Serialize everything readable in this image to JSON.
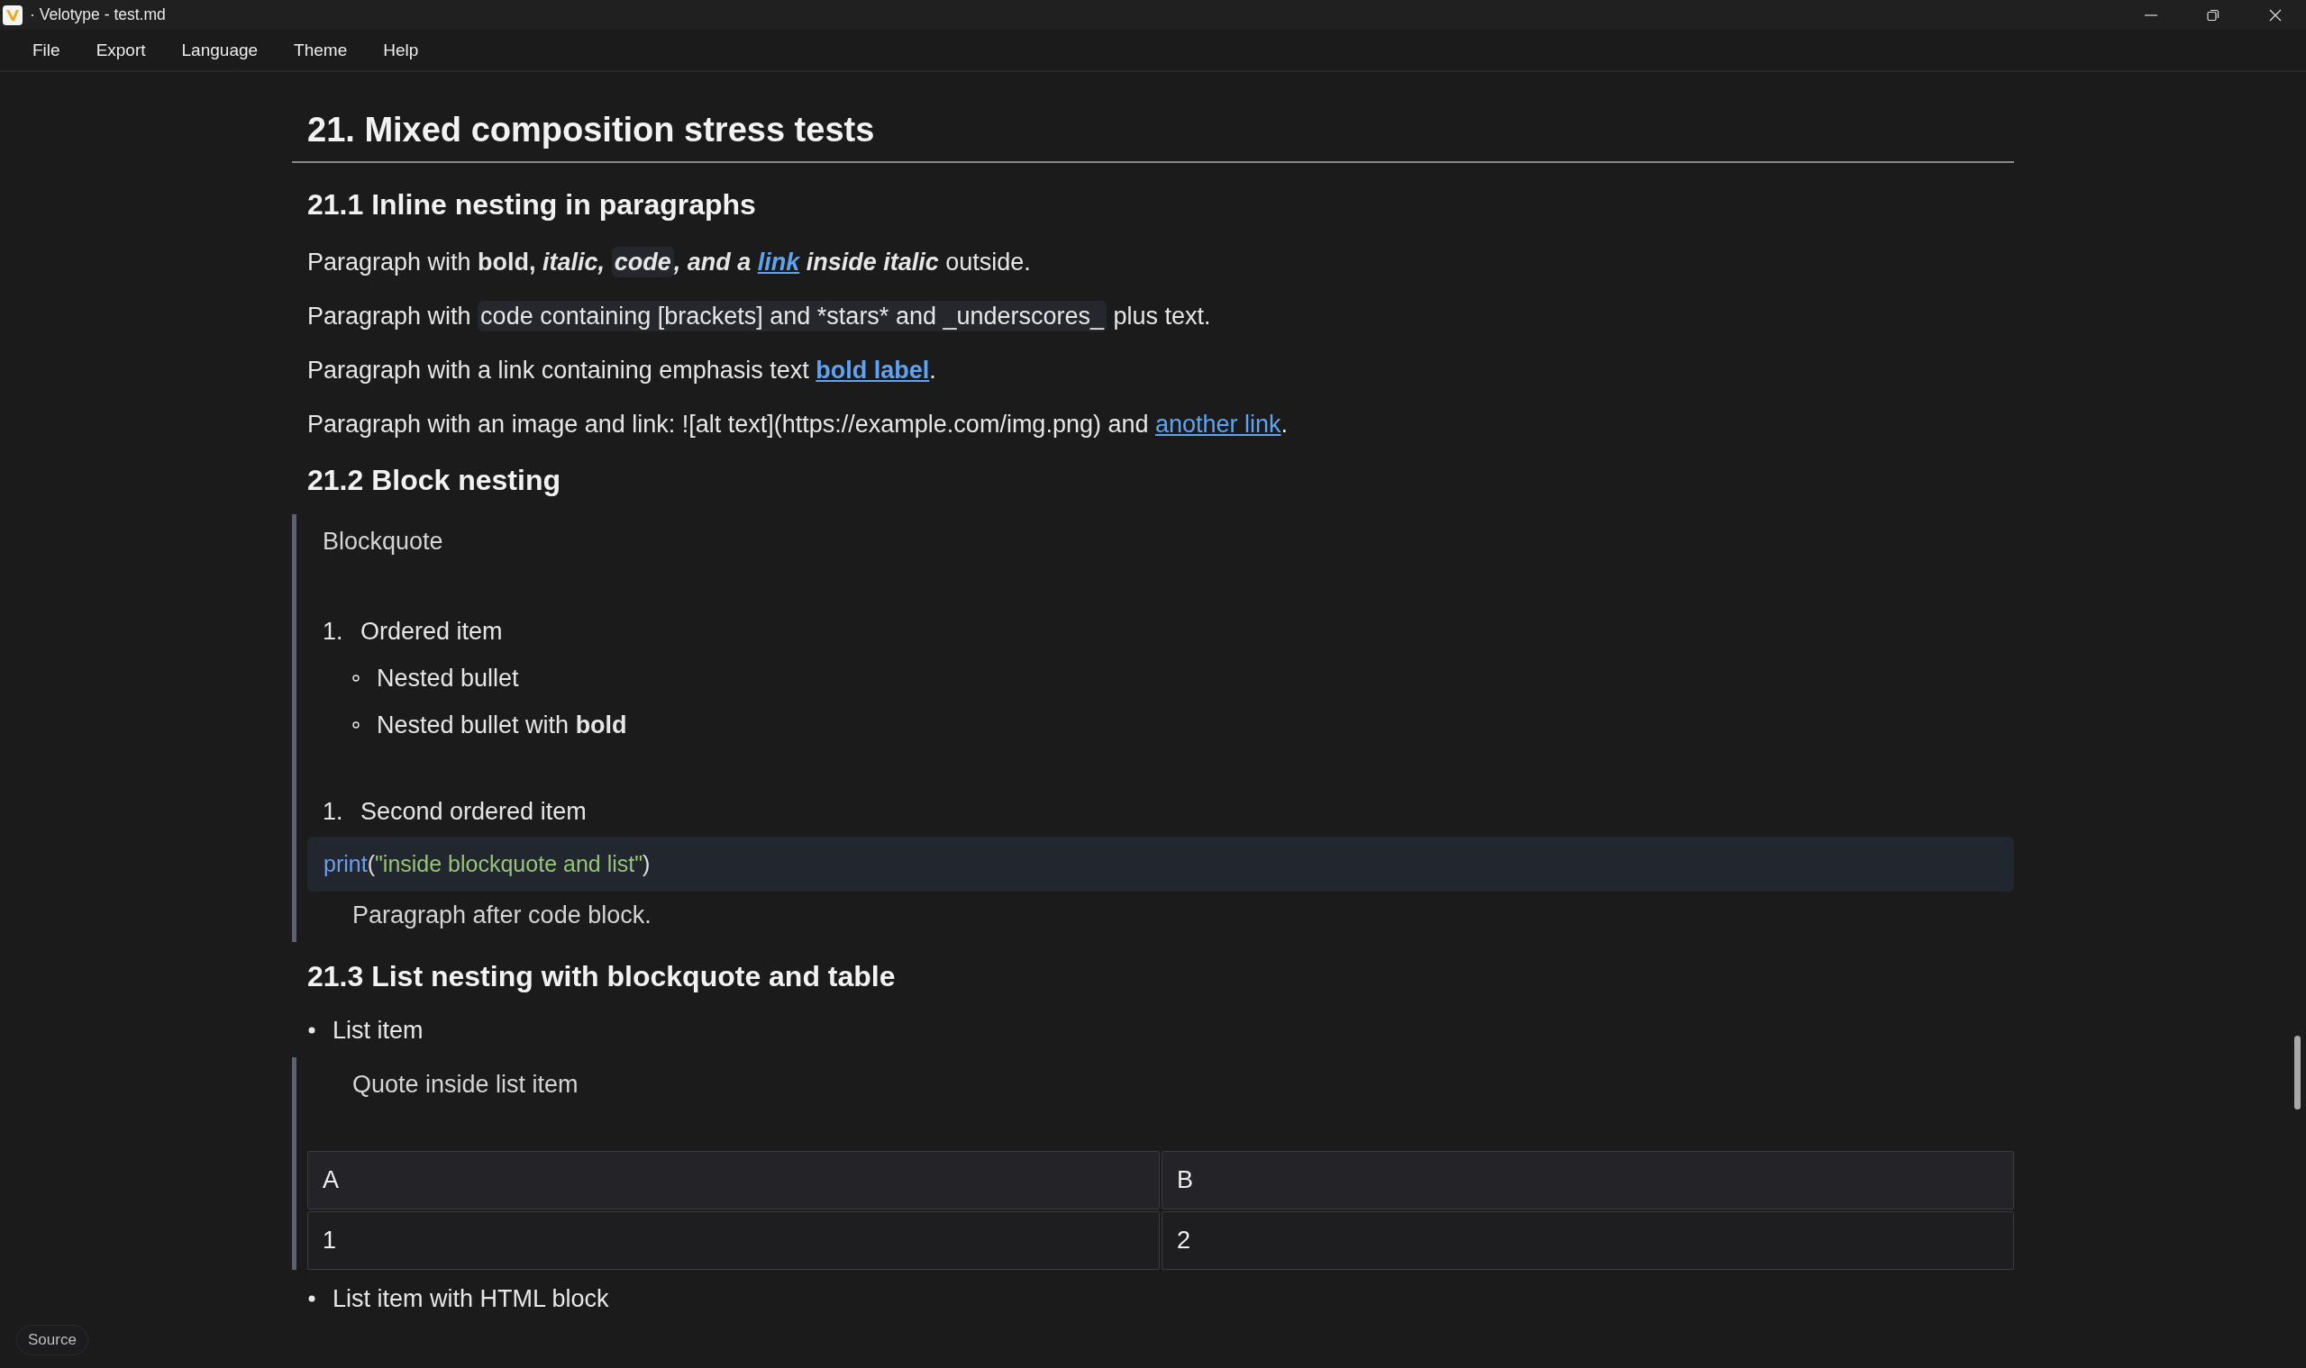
{
  "window": {
    "title": "· Velotype - test.md"
  },
  "menu": [
    {
      "label": "File"
    },
    {
      "label": "Export"
    },
    {
      "label": "Language"
    },
    {
      "label": "Theme"
    },
    {
      "label": "Help"
    }
  ],
  "document": [
    {
      "kind": "h1",
      "text": "21. Mixed composition stress tests"
    },
    {
      "kind": "h2",
      "text": "21.1 Inline nesting in paragraphs"
    },
    {
      "kind": "paragraph",
      "spans": [
        {
          "text": "Paragraph with "
        },
        {
          "text": "bold, ",
          "bold": true
        },
        {
          "text": "italic, ",
          "bold": true,
          "italic": true
        },
        {
          "text": "code",
          "bold": true,
          "italic": true,
          "code": true
        },
        {
          "text": ", and a ",
          "bold": true,
          "italic": true
        },
        {
          "text": "link",
          "bold": true,
          "italic": true,
          "link": true
        },
        {
          "text": " inside italic",
          "bold": true,
          "italic": true
        },
        {
          "text": " outside."
        }
      ]
    },
    {
      "kind": "paragraph",
      "spans": [
        {
          "text": "Paragraph with "
        },
        {
          "text": "code containing [brackets] and *stars* and _underscores_",
          "code": true
        },
        {
          "text": " plus text."
        }
      ]
    },
    {
      "kind": "paragraph",
      "spans": [
        {
          "text": "Paragraph with a link containing emphasis text "
        },
        {
          "text": "bold label",
          "bold": true,
          "link": true
        },
        {
          "text": "."
        }
      ]
    },
    {
      "kind": "paragraph",
      "spans": [
        {
          "text": "Paragraph with an image and link: ![alt text](https://example.com/img.png) and "
        },
        {
          "text": "another link",
          "link": true
        },
        {
          "text": "."
        }
      ]
    },
    {
      "kind": "h2",
      "text": "21.2 Block nesting"
    },
    {
      "kind": "blockquote",
      "children": [
        {
          "kind": "paragraph",
          "spans": [
            {
              "text": "Blockquote"
            }
          ]
        },
        {
          "kind": "ordered_list",
          "items": [
            {
              "marker": "1.",
              "spans": [
                {
                  "text": "Ordered item"
                }
              ],
              "children": [
                {
                  "kind": "bullet_list",
                  "items": [
                    {
                      "spans": [
                        {
                          "text": "Nested bullet"
                        }
                      ]
                    },
                    {
                      "spans": [
                        {
                          "text": "Nested bullet with "
                        },
                        {
                          "text": "bold",
                          "bold": true
                        }
                      ]
                    }
                  ]
                }
              ]
            }
          ]
        },
        {
          "kind": "ordered_list",
          "items": [
            {
              "marker": "1.",
              "spans": [
                {
                  "text": "Second ordered item"
                }
              ]
            }
          ]
        },
        {
          "kind": "code",
          "tokens": [
            {
              "kind": "function",
              "text": "print"
            },
            {
              "kind": "punct",
              "text": "("
            },
            {
              "kind": "string",
              "text": "\"inside blockquote and list\""
            },
            {
              "kind": "punct",
              "text": ")"
            }
          ]
        },
        {
          "kind": "paragraph",
          "indented": true,
          "spans": [
            {
              "text": "Paragraph after code block."
            }
          ]
        }
      ]
    },
    {
      "kind": "h2",
      "text": "21.3 List nesting with blockquote and table"
    },
    {
      "kind": "bullet_list",
      "items": [
        {
          "spans": [
            {
              "text": "List item"
            }
          ]
        }
      ]
    },
    {
      "kind": "blockquote",
      "children": [
        {
          "kind": "paragraph",
          "indented": true,
          "spans": [
            {
              "text": "Quote inside list item"
            }
          ]
        },
        {
          "kind": "table",
          "columns": [
            "A",
            "B"
          ],
          "rows": [
            [
              "1",
              "2"
            ]
          ]
        }
      ]
    },
    {
      "kind": "bullet_list",
      "items": [
        {
          "spans": [
            {
              "text": "List item with HTML block"
            }
          ]
        }
      ]
    }
  ],
  "source_button": {
    "label": "Source"
  }
}
